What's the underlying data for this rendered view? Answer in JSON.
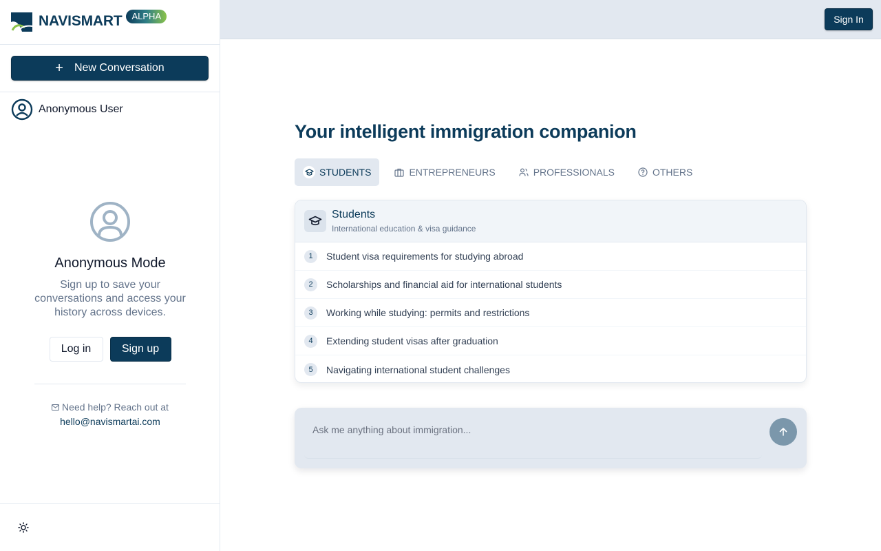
{
  "brand": {
    "name": "NAVISMART",
    "badge": "ALPHA"
  },
  "sidebar": {
    "new_conversation": "New Conversation",
    "user_name": "Anonymous User",
    "anon": {
      "title": "Anonymous Mode",
      "description": "Sign up to save your conversations and access your history across devices.",
      "login": "Log in",
      "signup": "Sign up"
    },
    "help": {
      "text": "Need help? Reach out at",
      "email": "hello@navismartai.com"
    }
  },
  "header": {
    "sign_in": "Sign In"
  },
  "main": {
    "headline": "Your intelligent immigration companion",
    "tabs": [
      {
        "label": "STUDENTS",
        "icon": "graduation-cap-icon",
        "active": true
      },
      {
        "label": "ENTREPRENEURS",
        "icon": "briefcase-icon",
        "active": false
      },
      {
        "label": "PROFESSIONALS",
        "icon": "users-icon",
        "active": false
      },
      {
        "label": "OTHERS",
        "icon": "help-circle-icon",
        "active": false
      }
    ],
    "card": {
      "title": "Students",
      "subtitle": "International education & visa guidance",
      "items": [
        {
          "num": "1",
          "text": "Student visa requirements for studying abroad"
        },
        {
          "num": "2",
          "text": "Scholarships and financial aid for international students"
        },
        {
          "num": "3",
          "text": "Working while studying: permits and restrictions"
        },
        {
          "num": "4",
          "text": "Extending student visas after graduation"
        },
        {
          "num": "5",
          "text": "Navigating international student challenges"
        }
      ]
    },
    "composer": {
      "placeholder": "Ask me anything about immigration..."
    }
  },
  "colors": {
    "primary": "#0c3b5a",
    "muted": "#64748b",
    "surface": "#e2e8f0",
    "send": "#7b97ab"
  }
}
